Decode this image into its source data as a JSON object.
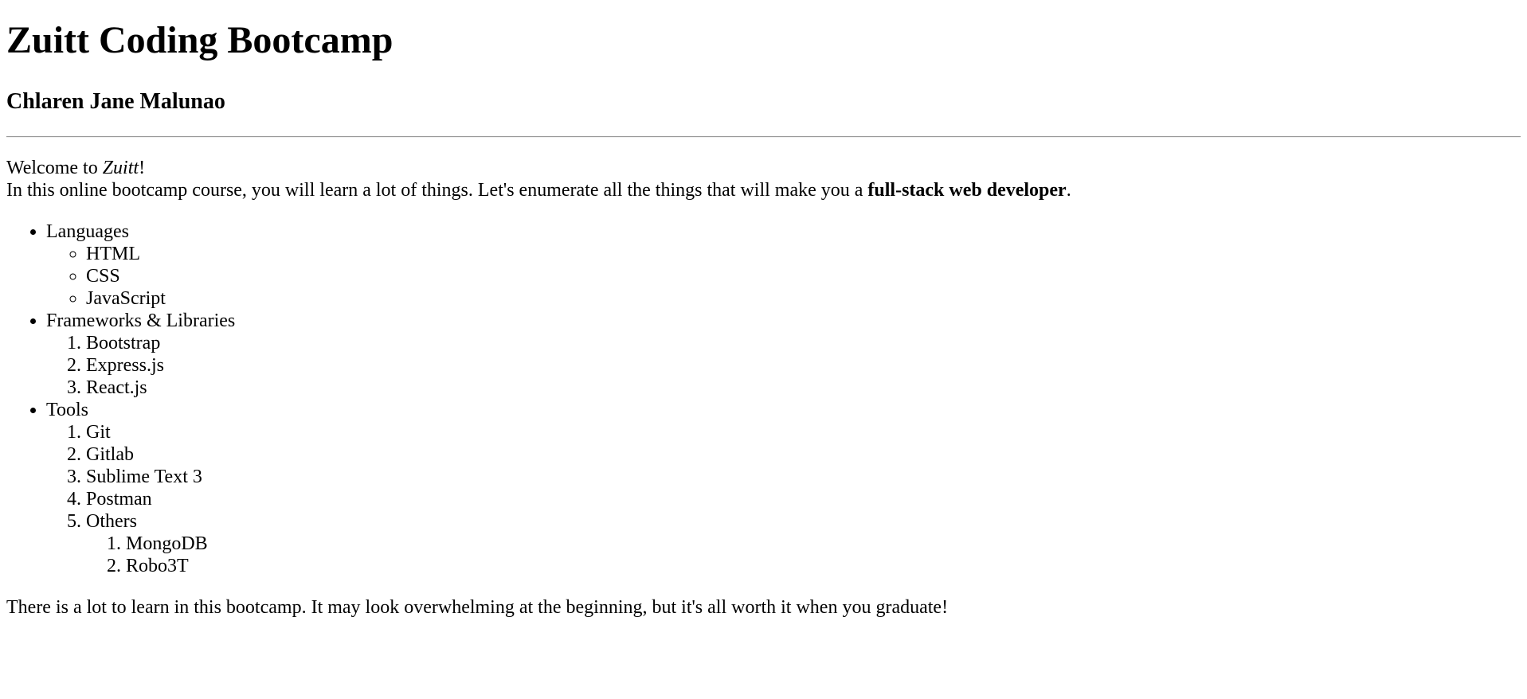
{
  "header": {
    "title": "Zuitt Coding Bootcamp",
    "author": "Chlaren Jane Malunao"
  },
  "intro": {
    "welcome_prefix": "Welcome to ",
    "welcome_brand": "Zuitt",
    "welcome_suffix": "!",
    "line2_prefix": "In this online bootcamp course, you will learn a lot of things. Let's enumerate all the things that will make you a ",
    "line2_bold": "full-stack web developer",
    "line2_suffix": "."
  },
  "categories": [
    {
      "label": "Languages",
      "items": [
        "HTML",
        "CSS",
        "JavaScript"
      ]
    },
    {
      "label": "Frameworks & Libraries",
      "items": [
        "Bootstrap",
        "Express.js",
        "React.js"
      ]
    },
    {
      "label": "Tools",
      "items": [
        "Git",
        "Gitlab",
        "Sublime Text 3",
        "Postman",
        "Others"
      ],
      "others_items": [
        "MongoDB",
        "Robo3T"
      ]
    }
  ],
  "closing": "There is a lot to learn in this bootcamp. It may look overwhelming at the beginning, but it's all worth it when you graduate!"
}
